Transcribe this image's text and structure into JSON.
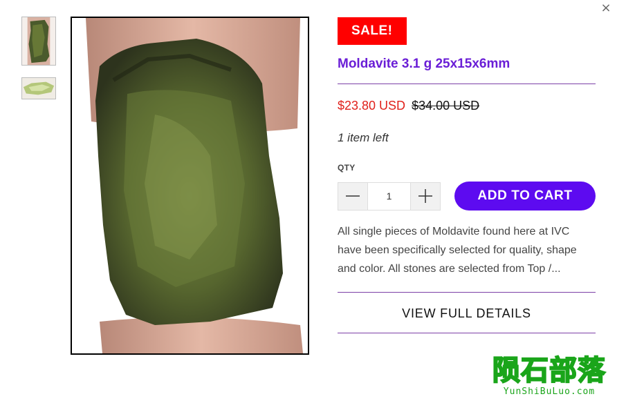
{
  "modal": {
    "close_symbol": "×"
  },
  "gallery": {
    "thumbnails": [
      {
        "alt": "Moldavite front view"
      },
      {
        "alt": "Moldavite side view"
      }
    ],
    "main_alt": "Moldavite held between fingers"
  },
  "product": {
    "badge": "SALE!",
    "title": "Moldavite 3.1 g 25x15x6mm",
    "price_sale": "$23.80 USD",
    "price_original": "$34.00 USD",
    "stock": "1 item left",
    "qty_label": "QTY",
    "qty_value": "1",
    "add_to_cart": "ADD TO CART",
    "description": "All single pieces of Moldavite found here at IVC have been specifically selected for quality, shape and color. All stones are selected from Top /...",
    "view_details": "VIEW FULL DETAILS"
  },
  "watermark": {
    "main": "陨石部落",
    "sub": "YunShiBuLuo.com"
  },
  "colors": {
    "sale_badge": "#ff0000",
    "title": "#6a1ed6",
    "sale_price": "#e0211b",
    "cart_button": "#5d0bf0",
    "divider": "#7b3fa6",
    "watermark": "#1aa51a"
  },
  "icons": {
    "close": "close-icon",
    "minus": "minus-icon",
    "plus": "plus-icon"
  }
}
